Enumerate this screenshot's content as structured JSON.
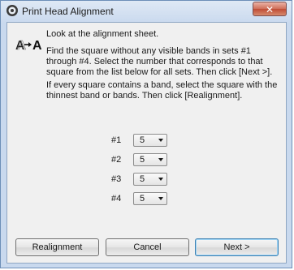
{
  "window": {
    "title": "Print Head Alignment",
    "close_label": "✕"
  },
  "content": {
    "instruction_1": "Look at the alignment sheet.",
    "instruction_2": "Find the square without any visible bands in sets #1 through #4. Select the number that corresponds to that square from the list below for all sets. Then click [Next >].",
    "instruction_3": "If every square contains a band, select the square with the thinnest band or bands. Then click [Realignment]."
  },
  "sets": [
    {
      "label": "#1",
      "value": "5"
    },
    {
      "label": "#2",
      "value": "5"
    },
    {
      "label": "#3",
      "value": "5"
    },
    {
      "label": "#4",
      "value": "5"
    }
  ],
  "buttons": {
    "realignment": "Realignment",
    "cancel": "Cancel",
    "next": "Next >"
  },
  "icons": {
    "app": "printer-app-icon",
    "alignment": "alignment-aa-icon",
    "dropdown": "chevron-down-icon"
  },
  "colors": {
    "titlebar": "#c9d9ee",
    "close": "#c04d36",
    "client_bg": "#f0f0f0",
    "default_border": "#3c7fb1"
  }
}
